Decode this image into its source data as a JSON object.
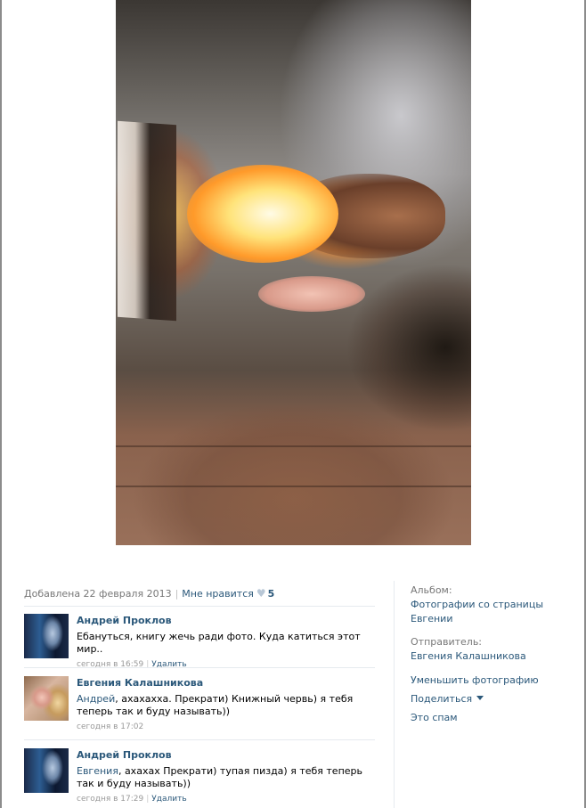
{
  "photo": {
    "alt_icon": "photo-image"
  },
  "meta": {
    "added": "Добавлена 22 февраля 2013",
    "separator": "|",
    "like_label": "Мне нравится",
    "heart_icon": "heart-icon",
    "like_count": "5"
  },
  "comments": [
    {
      "author": "Андрей Проклов",
      "mention": "",
      "text": "Ебануться, книгу жечь ради фото. Куда катиться этот мир..",
      "time": "сегодня в 16:59",
      "delete_label": "Удалить"
    },
    {
      "author": "Евгения Калашникова",
      "mention": "Андрей",
      "text": ", ахахахха. Прекрати) Книжный червь) я тебя теперь так и буду называть))",
      "time": "сегодня в 17:02",
      "delete_label": ""
    },
    {
      "author": "Андрей Проклов",
      "mention": "Евгения",
      "text": ", ахахах Прекрати) тупая пизда) я тебя теперь так и буду называть))",
      "time": "сегодня в 17:29",
      "delete_label": "Удалить"
    }
  ],
  "side": {
    "album_label": "Альбом:",
    "album_link_line1": "Фотографии со страницы",
    "album_link_line2": "Евгении",
    "sender_label": "Отправитель:",
    "sender_link": "Евгения Калашникова",
    "reduce_link": "Уменьшить фотографию",
    "share_link": "Поделиться",
    "spam_link": "Это спам"
  },
  "colors": {
    "link": "#2b587a",
    "muted": "#777777",
    "divider": "#e6eaef"
  }
}
